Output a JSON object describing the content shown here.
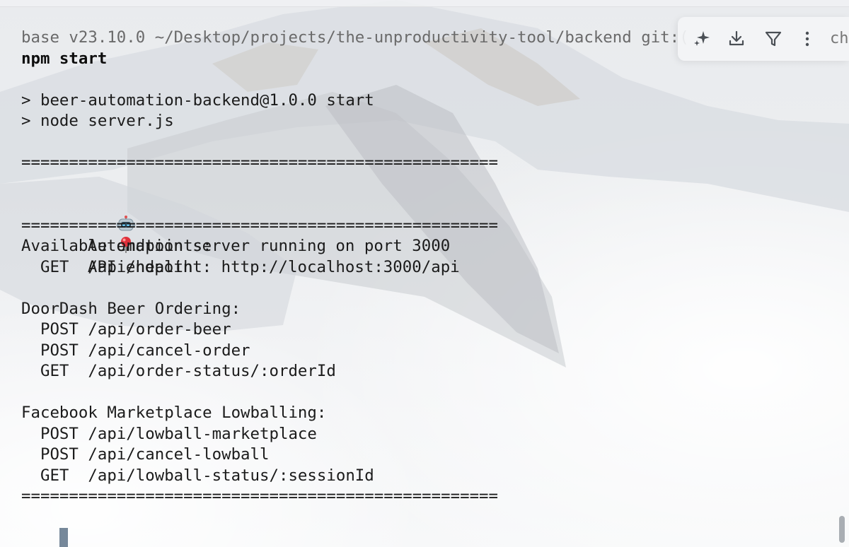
{
  "terminal": {
    "prompt": "base v23.10.0 ~/Desktop/projects/the-unproductivity-tool/backend git:(",
    "command": "npm start",
    "lines": [
      "",
      "",
      "> beer-automation-backend@1.0.0 start",
      "> node server.js",
      "",
      "==================================================",
      "Automation server running on port 3000",
      "API endpoint: http://localhost:3000/api",
      "==================================================",
      "Available endpoints:",
      "  GET  /api/health",
      "",
      "DoorDash Beer Ordering:",
      "  POST /api/order-beer",
      "  POST /api/cancel-order",
      "  GET  /api/order-status/:orderId",
      "",
      "Facebook Marketplace Lowballing:",
      "  POST /api/lowball-marketplace",
      "  POST /api/cancel-lowball",
      "  GET  /api/lowball-status/:sessionId",
      "=================================================="
    ],
    "icons": {
      "robot": "robot-emoji-icon",
      "pin": "round-pushpin-emoji-icon"
    }
  },
  "toolbar": {
    "partial_text": "cha",
    "buttons": [
      {
        "name": "ai-sparkle-button",
        "icon": "sparkle-icon"
      },
      {
        "name": "download-button",
        "icon": "download-icon"
      },
      {
        "name": "filter-button",
        "icon": "filter-icon"
      },
      {
        "name": "more-options-button",
        "icon": "vertical-dots-icon"
      }
    ]
  },
  "colors": {
    "text": "#1b1b1b",
    "prompt_text": "#6a6a6a",
    "cursor": "#76889a",
    "toolbar_bg": "#f3f4f6"
  }
}
